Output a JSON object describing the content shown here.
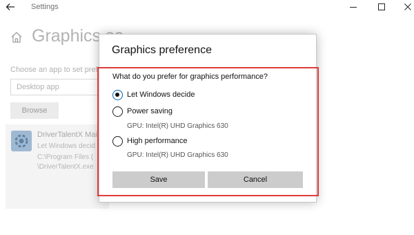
{
  "window": {
    "title": "Settings"
  },
  "background": {
    "page_title": "Graphics se",
    "choose_label": "Choose an app to set prefe",
    "app_select_value": "Desktop app",
    "browse_label": "Browse",
    "app": {
      "name": "DriverTalentX Mai",
      "preference": "Let Windows decid",
      "path_line1": "C:\\Program Files (",
      "path_line2": "\\DriverTalentX.exe"
    }
  },
  "dialog": {
    "title": "Graphics preference",
    "question": "What do you prefer for graphics performance?",
    "options": [
      {
        "label": "Let Windows decide",
        "checked": true,
        "gpu": ""
      },
      {
        "label": "Power saving",
        "checked": false,
        "gpu": "GPU: Intel(R) UHD Graphics 630"
      },
      {
        "label": "High performance",
        "checked": false,
        "gpu": "GPU: Intel(R) UHD Graphics 630"
      }
    ],
    "save_label": "Save",
    "cancel_label": "Cancel"
  },
  "colors": {
    "highlight_border": "#e23a3a",
    "radio_accent": "#0063b1",
    "button_bg": "#cccccc"
  }
}
